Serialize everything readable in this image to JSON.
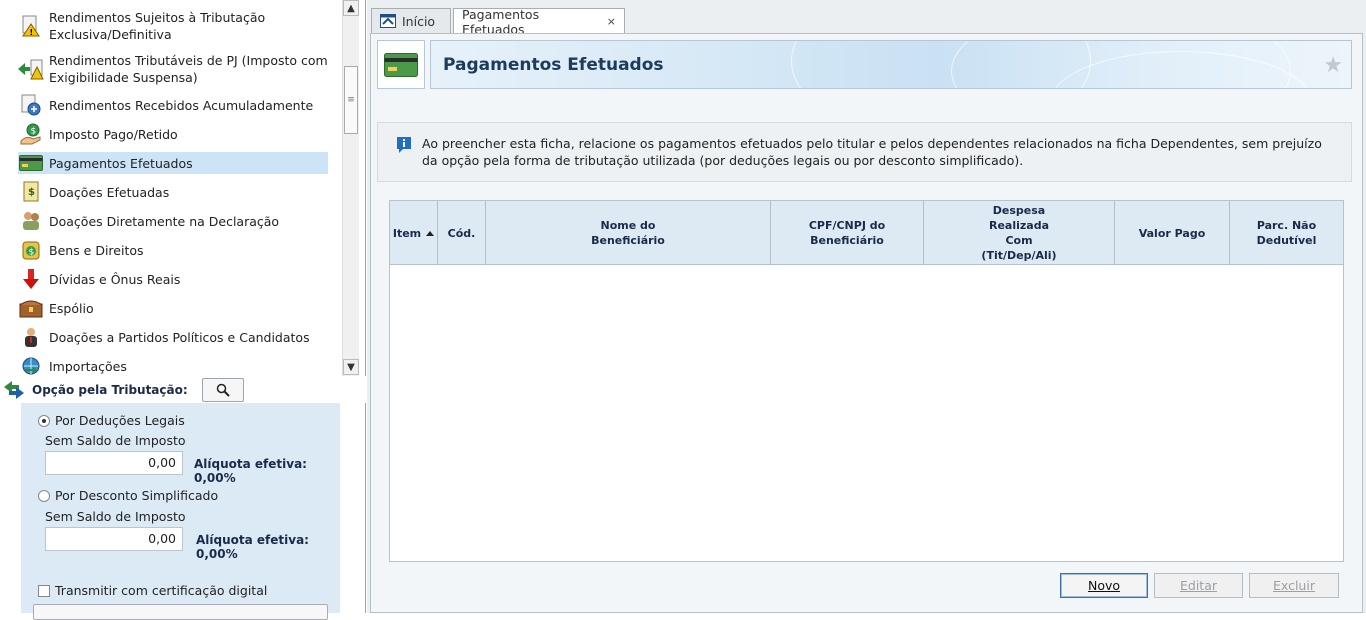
{
  "sidebar": {
    "items": [
      {
        "label": "Rendimentos Sujeitos à Tributação\nExclusiva/Definitiva",
        "icon": "warning-doc-icon"
      },
      {
        "label": "Rendimentos Tributáveis de PJ (Imposto com\nExigibilidade Suspensa)",
        "icon": "suspended-income-icon"
      },
      {
        "label": "Rendimentos Recebidos Acumuladamente",
        "icon": "accumulated-income-icon"
      },
      {
        "label": "Imposto Pago/Retido",
        "icon": "hand-coin-icon"
      },
      {
        "label": "Pagamentos Efetuados",
        "icon": "credit-card-icon",
        "selected": true
      },
      {
        "label": "Doações Efetuadas",
        "icon": "donation-doc-icon"
      },
      {
        "label": "Doações Diretamente na Declaração",
        "icon": "people-donation-icon"
      },
      {
        "label": "Bens e Direitos",
        "icon": "money-bag-icon"
      },
      {
        "label": "Dívidas e Ônus Reais",
        "icon": "red-down-arrow-icon"
      },
      {
        "label": "Espólio",
        "icon": "treasure-chest-icon"
      },
      {
        "label": "Doações a Partidos Políticos e Candidatos",
        "icon": "politician-icon"
      },
      {
        "label": "Importações",
        "icon": "import-globe-icon"
      }
    ]
  },
  "tributacao": {
    "label": "Opção pela Tributação:",
    "option1": {
      "label": "Por Deduções Legais",
      "selected": true,
      "sub": "Sem Saldo de Imposto",
      "value": "0,00",
      "aliquota": "Alíquota efetiva: 0,00%"
    },
    "option2": {
      "label": "Por Desconto Simplificado",
      "selected": false,
      "sub": "Sem Saldo de Imposto",
      "value": "0,00",
      "aliquota": "Alíquota efetiva: 0,00%"
    },
    "transmit_label": "Transmitir com certificação digital"
  },
  "tabs": [
    {
      "label": "Início",
      "active": false
    },
    {
      "label": "Pagamentos Efetuados",
      "active": true,
      "close": "×"
    }
  ],
  "page": {
    "title": "Pagamentos Efetuados",
    "info": "Ao preencher esta ficha, relacione os pagamentos efetuados pelo titular e pelos dependentes relacionados na ficha Dependentes, sem prejuízo da opção pela forma de tributação utilizada (por deduções legais ou por desconto simplificado)."
  },
  "table": {
    "columns": [
      "Item",
      "Cód.",
      "Nome do\nBeneficiário",
      "CPF/CNPJ do\nBeneficiário",
      "Despesa\nRealizada\nCom\n(Tit/Dep/Ali)",
      "Valor Pago",
      "Parc. Não\nDedutível"
    ],
    "rows": []
  },
  "buttons": {
    "novo": "Novo",
    "editar": "Editar",
    "excluir": "Excluir"
  },
  "colors": {
    "selected_row": "#cde4f7",
    "panel": "#dceaf6",
    "header_blue": "#1d3c5c"
  }
}
